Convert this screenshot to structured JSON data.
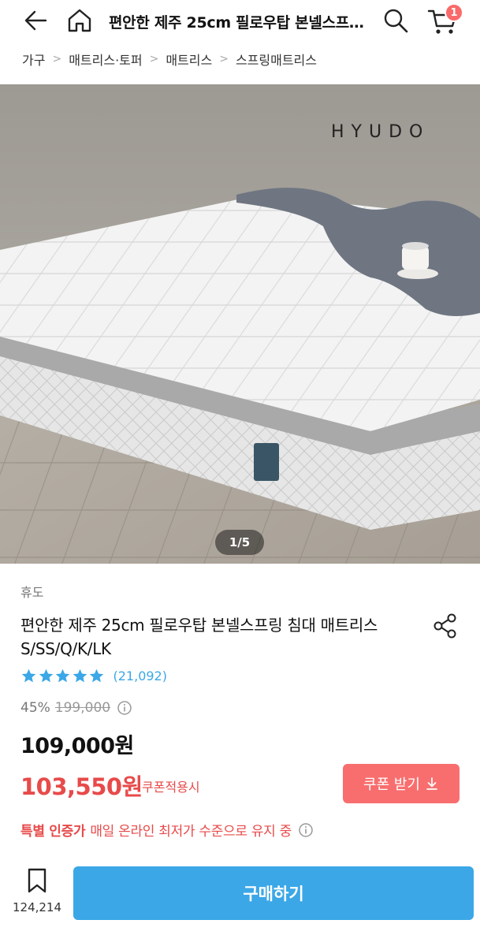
{
  "header": {
    "title": "편안한 제주 25cm 필로우탑 본넬스프링 침대 매트리스 S/SS/Q/K/LK",
    "cart_count": "1"
  },
  "breadcrumb": [
    "가구",
    "매트리스·토퍼",
    "매트리스",
    "스프링매트리스"
  ],
  "image": {
    "brand_watermark": "HYUDO",
    "pager": "1/5"
  },
  "product": {
    "brand": "휴도",
    "name": "편안한 제주 25cm 필로우탑 본넬스프링 침대 매트리스 S/SS/Q/K/LK",
    "rating_stars": 5,
    "review_count": "(21,092)",
    "discount": "45%",
    "original_price": "199,000",
    "price": "109,000원",
    "coupon_price": "103,550원",
    "coupon_note": "쿠폰적용시",
    "coupon_button": "쿠폰 받기",
    "certify_label": "특별 인증가",
    "certify_text": "매일 온라인 최저가 수준으로 유지 중"
  },
  "bottom_bar": {
    "wishlist_count": "124,214",
    "buy_label": "구매하기"
  },
  "colors": {
    "accent_blue": "#3ba7e7",
    "accent_red": "#e84a4a",
    "coupon_button": "#f86e6e"
  }
}
